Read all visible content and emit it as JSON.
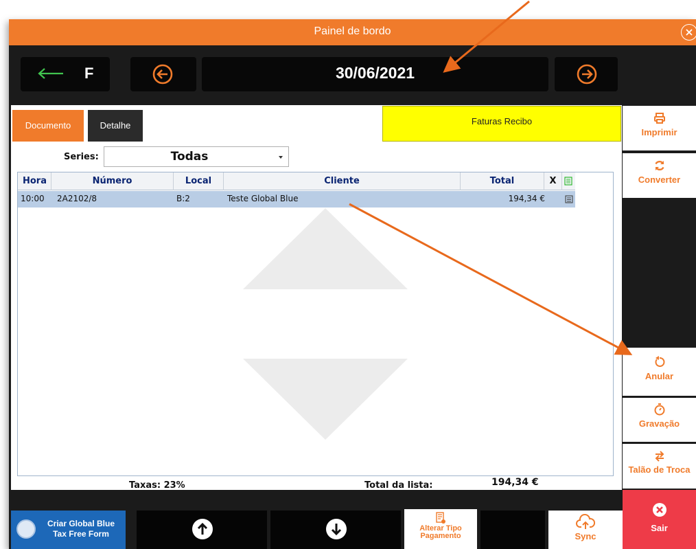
{
  "window": {
    "title": "Painel de bordo"
  },
  "topbar": {
    "mode_letter": "F",
    "date": "30/06/2021"
  },
  "tabs": [
    {
      "label": "Documento",
      "active": true
    },
    {
      "label": "Detalhe",
      "active": false
    }
  ],
  "doc_type": "Faturas Recibo",
  "series": {
    "label": "Series:",
    "value": "Todas"
  },
  "grid": {
    "columns": {
      "hora": "Hora",
      "numero": "Número",
      "local": "Local",
      "cliente": "Cliente",
      "total": "Total",
      "x": "X"
    },
    "rows": [
      {
        "hora": "10:00",
        "numero": "2A2102/8",
        "local": "B:2",
        "cliente": "Teste Global Blue",
        "total": "194,34 €"
      }
    ]
  },
  "footer": {
    "taxas": "Taxas: 23%",
    "total_label": "Total da lista:",
    "total_value": "194,34 €"
  },
  "side": {
    "imprimir": "Imprimir",
    "converter": "Converter",
    "anular": "Anular",
    "gravacao": "Gravação",
    "talao": "Talão de Troca",
    "sair": "Sair"
  },
  "bottom": {
    "global_blue_l1": "Criar Global Blue",
    "global_blue_l2": "Tax Free Form",
    "alterar_l1": "Alterar Tipo",
    "alterar_l2": "Pagamento",
    "sync": "Sync"
  },
  "colors": {
    "accent": "#f07b2b",
    "danger": "#ee3b48",
    "highlight": "#ffff00",
    "row_selected": "#b9cde5",
    "global_blue": "#1d68b8"
  }
}
